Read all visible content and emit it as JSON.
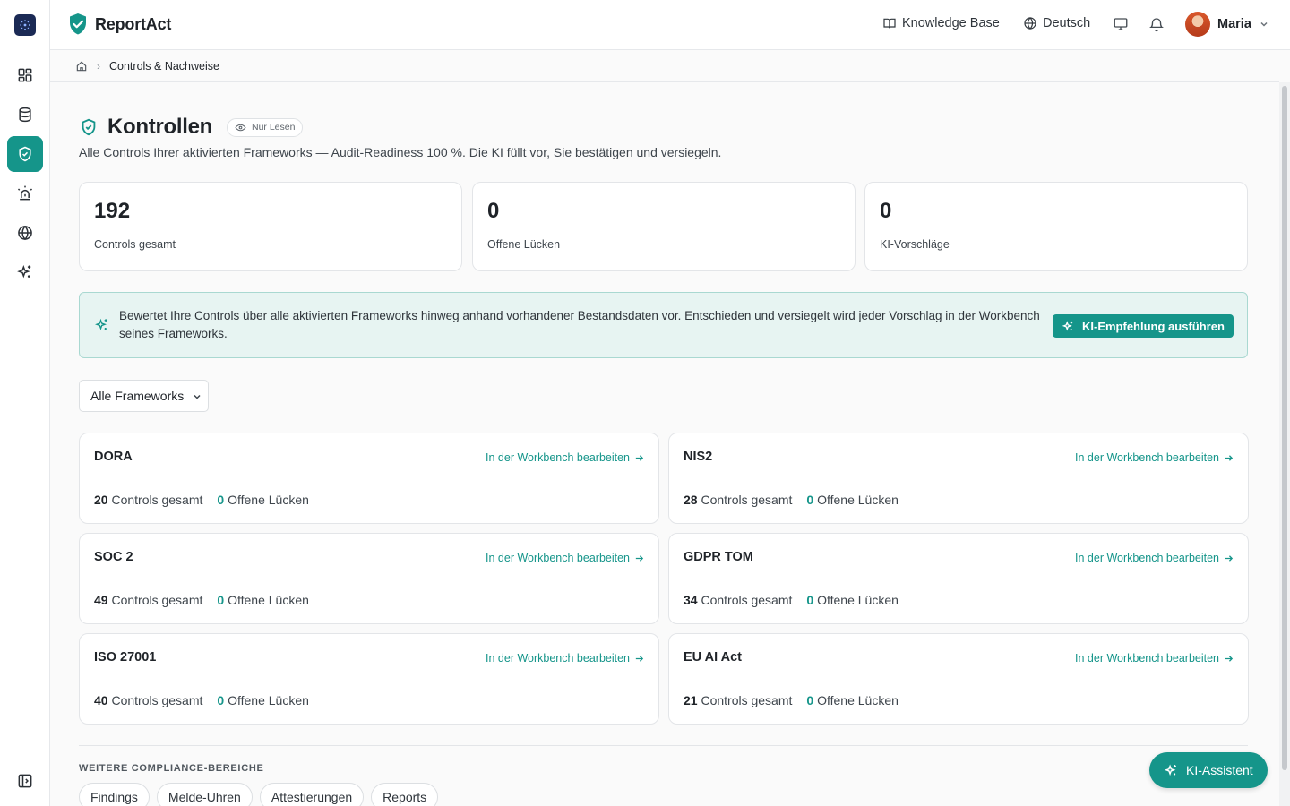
{
  "brand": {
    "name": "ReportAct"
  },
  "header": {
    "knowledge_base": "Knowledge Base",
    "language": "Deutsch",
    "user_name": "Maria"
  },
  "breadcrumb": {
    "current": "Controls & Nachweise"
  },
  "page": {
    "title": "Kontrollen",
    "badge": "Nur Lesen",
    "subtitle": "Alle Controls Ihrer aktivierten Frameworks — Audit-Readiness 100 %. Die KI füllt vor, Sie bestätigen und versiegeln."
  },
  "stats": [
    {
      "value": "192",
      "label": "Controls gesamt"
    },
    {
      "value": "0",
      "label": "Offene Lücken"
    },
    {
      "value": "0",
      "label": "KI-Vorschläge"
    }
  ],
  "banner": {
    "text": "Bewertet Ihre Controls über alle aktivierten Frameworks hinweg anhand vorhandener Bestandsdaten vor. Entschieden und versiegelt wird jeder Vorschlag in der Workbench seines Frameworks.",
    "button": "KI-Empfehlung ausführen"
  },
  "filter": {
    "selected": "Alle Frameworks"
  },
  "frameworks": [
    {
      "name": "DORA",
      "link": "In der Workbench bearbeiten",
      "controls": "20",
      "controls_label": "Controls gesamt",
      "gaps": "0",
      "gaps_label": "Offene Lücken"
    },
    {
      "name": "NIS2",
      "link": "In der Workbench bearbeiten",
      "controls": "28",
      "controls_label": "Controls gesamt",
      "gaps": "0",
      "gaps_label": "Offene Lücken"
    },
    {
      "name": "SOC 2",
      "link": "In der Workbench bearbeiten",
      "controls": "49",
      "controls_label": "Controls gesamt",
      "gaps": "0",
      "gaps_label": "Offene Lücken"
    },
    {
      "name": "GDPR TOM",
      "link": "In der Workbench bearbeiten",
      "controls": "34",
      "controls_label": "Controls gesamt",
      "gaps": "0",
      "gaps_label": "Offene Lücken"
    },
    {
      "name": "ISO 27001",
      "link": "In der Workbench bearbeiten",
      "controls": "40",
      "controls_label": "Controls gesamt",
      "gaps": "0",
      "gaps_label": "Offene Lücken"
    },
    {
      "name": "EU AI Act",
      "link": "In der Workbench bearbeiten",
      "controls": "21",
      "controls_label": "Controls gesamt",
      "gaps": "0",
      "gaps_label": "Offene Lücken"
    }
  ],
  "more": {
    "label": "WEITERE COMPLIANCE-BEREICHE",
    "pills": [
      "Findings",
      "Melde-Uhren",
      "Attestierungen",
      "Reports"
    ]
  },
  "assistant": {
    "label": "KI-Assistent"
  }
}
